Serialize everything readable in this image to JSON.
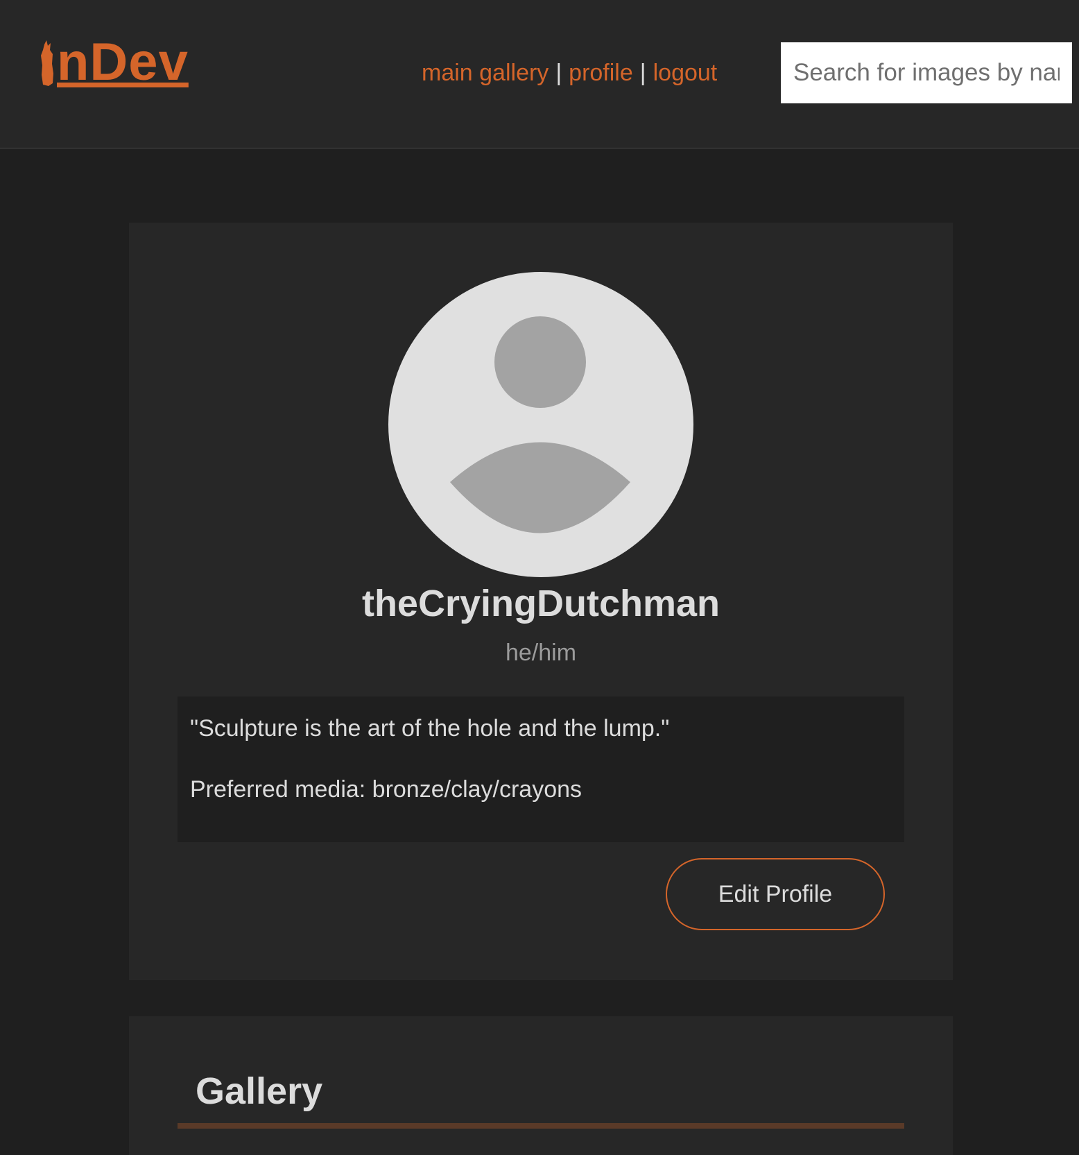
{
  "header": {
    "logo_text": "nDev",
    "logo_full": "InDev",
    "nav": [
      {
        "label": "main gallery"
      },
      {
        "label": "profile"
      },
      {
        "label": "logout"
      }
    ],
    "nav_separator": "|",
    "search_placeholder": "Search for images by name"
  },
  "profile": {
    "username": "theCryingDutchman",
    "pronouns": "he/him",
    "bio_quote": "\"Sculpture is the art of the hole and the lump.\"",
    "bio_media": "Preferred media: bronze/clay/crayons",
    "edit_button": "Edit Profile"
  },
  "gallery": {
    "title": "Gallery"
  },
  "colors": {
    "accent": "#d5652a",
    "background": "#1f1f1f",
    "card": "#272727",
    "text": "#dcdcdc",
    "muted": "#9b9b9b"
  },
  "icons": {
    "avatar": "default-user-avatar-icon"
  }
}
